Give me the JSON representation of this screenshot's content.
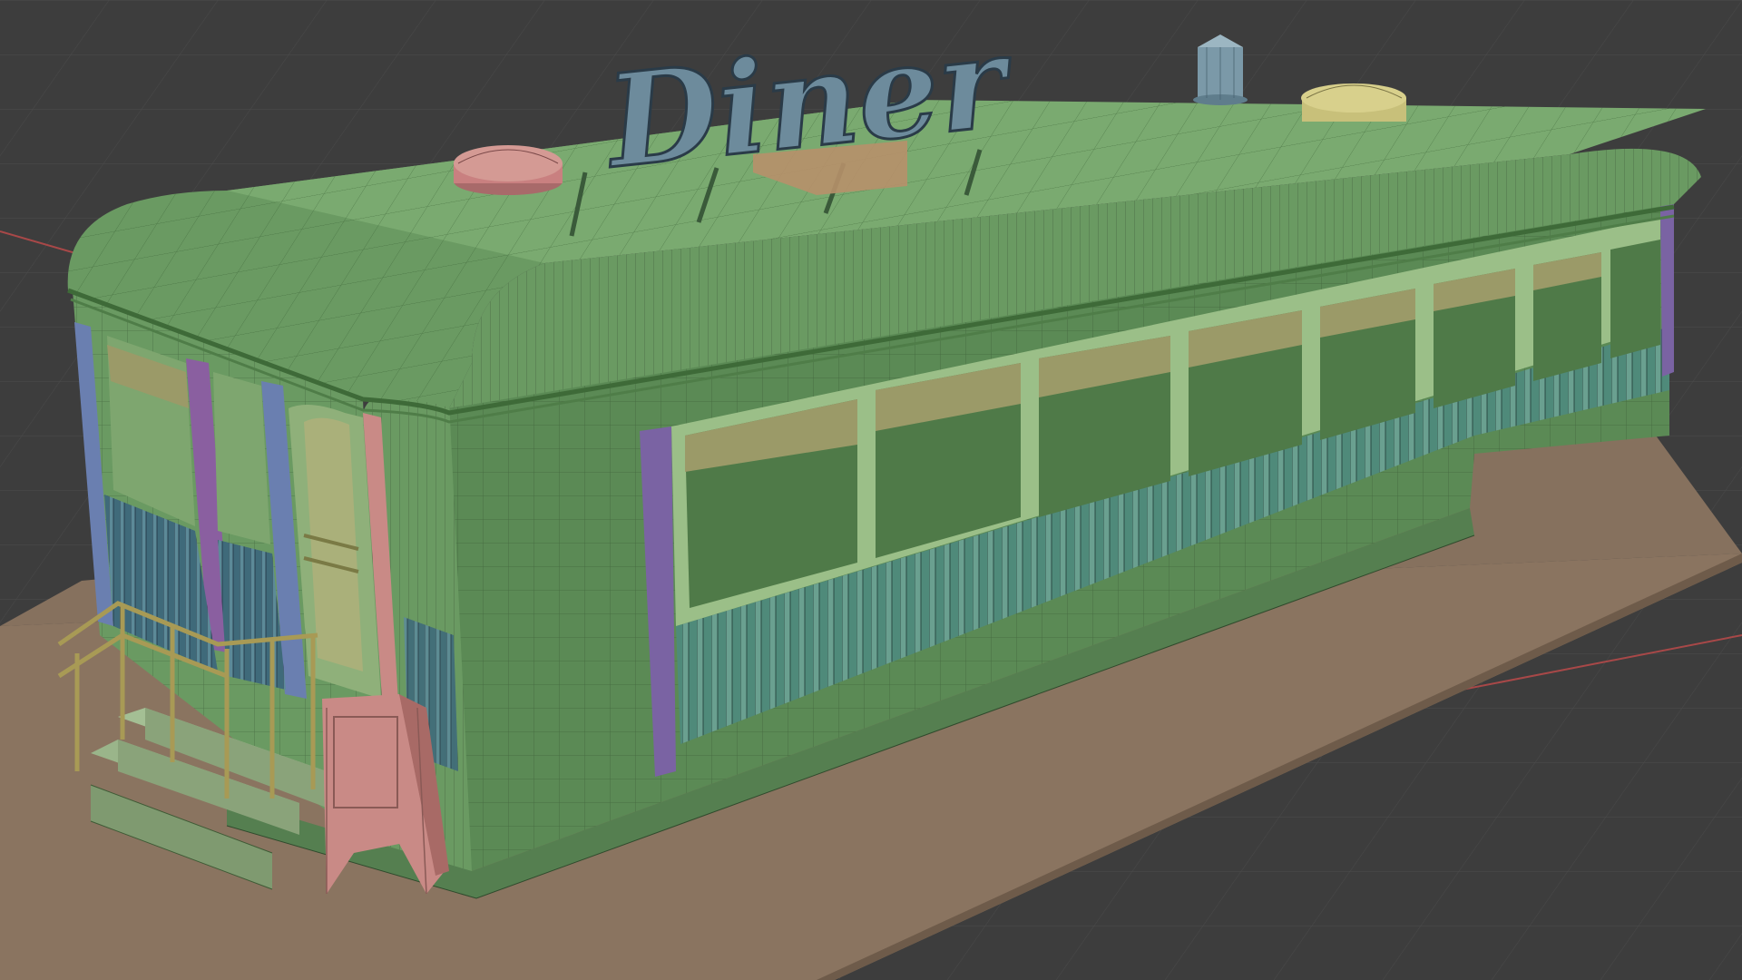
{
  "viewport": {
    "background_color": "#3d3d3d",
    "grid_line_color": "#4a4a4a",
    "axis_x_color": "#a84848",
    "shading_mode": "solid-with-wireframe-overlay"
  },
  "scene": {
    "sign_text": "Diner",
    "objects": [
      {
        "name": "ground-slab",
        "color": "#8a7460"
      },
      {
        "name": "diner-body",
        "color": "#5b8a55"
      },
      {
        "name": "diner-roof",
        "color": "#6a9a62"
      },
      {
        "name": "diner-sign",
        "color": "#6d8b9c"
      },
      {
        "name": "roof-vent-pink",
        "color": "#c98080"
      },
      {
        "name": "roof-vent-yellow",
        "color": "#c8c07a"
      },
      {
        "name": "chimney",
        "color": "#7b99a8"
      },
      {
        "name": "sandwich-board-sign",
        "color": "#c98a86"
      },
      {
        "name": "entry-stairs",
        "color": "#8aa37a"
      },
      {
        "name": "stair-railing",
        "color": "#a89a55"
      },
      {
        "name": "window-frames",
        "color": "#9bbf88"
      },
      {
        "name": "fluted-skirt",
        "color": "#4f8a7a"
      },
      {
        "name": "purple-trim",
        "color": "#7a63a3"
      },
      {
        "name": "blue-trim",
        "color": "#6a7fb0"
      }
    ]
  }
}
